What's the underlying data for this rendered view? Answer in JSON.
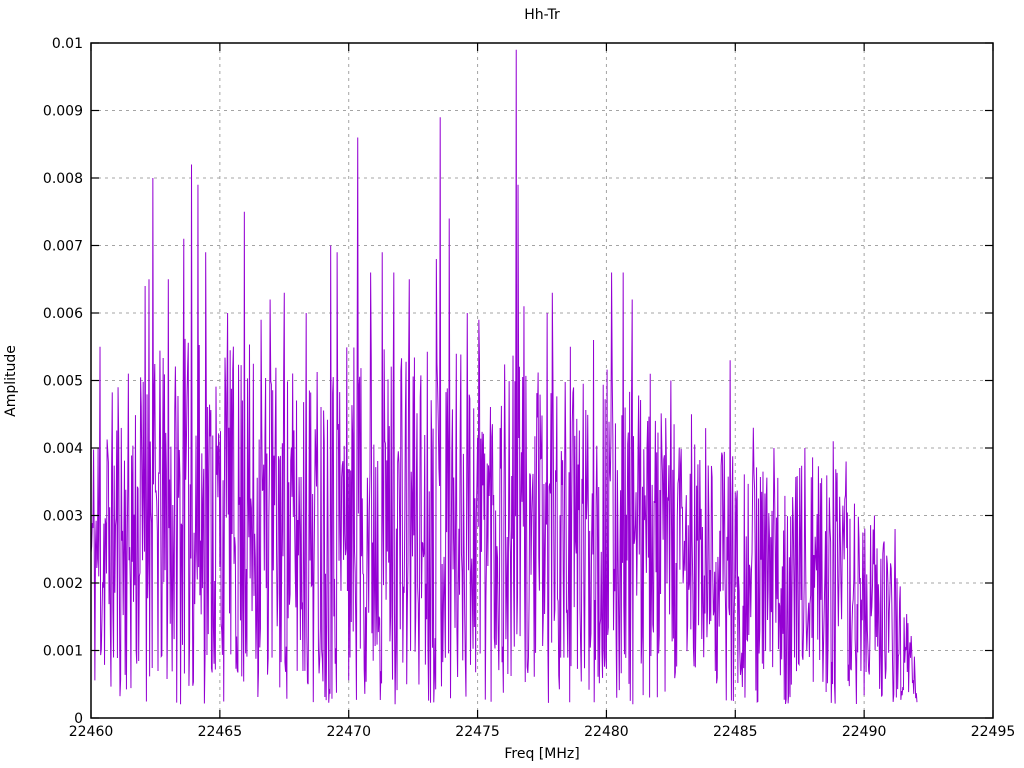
{
  "chart_data": {
    "type": "line",
    "title": "Hh-Tr",
    "xlabel": "Freq [MHz]",
    "ylabel": "Amplitude",
    "xlim": [
      22460,
      22495
    ],
    "ylim": [
      0,
      0.01
    ],
    "xtick_values": [
      22460,
      22465,
      22470,
      22475,
      22480,
      22485,
      22490,
      22495
    ],
    "xtick_labels": [
      "22460",
      "22465",
      "22470",
      "22475",
      "22480",
      "22485",
      "22490",
      "22495"
    ],
    "ytick_values": [
      0,
      0.001,
      0.002,
      0.003,
      0.004,
      0.005,
      0.006,
      0.007,
      0.008,
      0.009,
      0.01
    ],
    "ytick_labels": [
      "0",
      "0.001",
      "0.002",
      "0.003",
      "0.004",
      "0.005",
      "0.006",
      "0.007",
      "0.008",
      "0.009",
      "0.01"
    ],
    "grid": true,
    "legend_position": "none",
    "line_color": "#9400D3",
    "grid_color": "#a4a4a4",
    "border_color": "#000000",
    "data_range": [
      22460,
      22492.05
    ],
    "peaks": [
      [
        22460.35,
        0.0055
      ],
      [
        22461.05,
        0.0049
      ],
      [
        22462.1,
        0.0064
      ],
      [
        22462.25,
        0.0065
      ],
      [
        22462.4,
        0.008
      ],
      [
        22463.0,
        0.0065
      ],
      [
        22463.6,
        0.0071
      ],
      [
        22463.9,
        0.0082
      ],
      [
        22464.15,
        0.0079
      ],
      [
        22464.45,
        0.0069
      ],
      [
        22465.3,
        0.006
      ],
      [
        22465.95,
        0.0075
      ],
      [
        22466.6,
        0.0059
      ],
      [
        22466.95,
        0.0062
      ],
      [
        22467.5,
        0.0063
      ],
      [
        22468.35,
        0.006
      ],
      [
        22469.3,
        0.007
      ],
      [
        22469.55,
        0.0069
      ],
      [
        22470.35,
        0.0086
      ],
      [
        22470.85,
        0.0066
      ],
      [
        22471.3,
        0.0069
      ],
      [
        22471.75,
        0.0066
      ],
      [
        22472.35,
        0.0065
      ],
      [
        22473.4,
        0.0068
      ],
      [
        22473.55,
        0.0089
      ],
      [
        22473.9,
        0.0074
      ],
      [
        22474.6,
        0.006
      ],
      [
        22475.05,
        0.0059
      ],
      [
        22476.5,
        0.0099
      ],
      [
        22476.57,
        0.0079
      ],
      [
        22476.8,
        0.0061
      ],
      [
        22477.7,
        0.006
      ],
      [
        22477.9,
        0.0063
      ],
      [
        22478.6,
        0.0055
      ],
      [
        22479.5,
        0.0056
      ],
      [
        22480.2,
        0.0066
      ],
      [
        22480.65,
        0.0066
      ],
      [
        22481.0,
        0.0062
      ],
      [
        22481.7,
        0.0051
      ],
      [
        22482.5,
        0.005
      ],
      [
        22483.3,
        0.0045
      ],
      [
        22484.8,
        0.0053
      ],
      [
        22485.7,
        0.0043
      ],
      [
        22486.5,
        0.004
      ],
      [
        22487.7,
        0.004
      ],
      [
        22488.8,
        0.0041
      ],
      [
        22489.3,
        0.0038
      ],
      [
        22490.4,
        0.003
      ],
      [
        22491.2,
        0.0028
      ]
    ],
    "noise_model": {
      "seed": 11,
      "points_per_mhz": 40,
      "exponent": 1.0,
      "floor": 0.0002,
      "envelope_hi": [
        [
          22460,
          0.0046
        ],
        [
          22461,
          0.005
        ],
        [
          22462,
          0.0054
        ],
        [
          22463,
          0.0055
        ],
        [
          22464,
          0.0057
        ],
        [
          22465,
          0.0055
        ],
        [
          22466,
          0.0056
        ],
        [
          22467,
          0.0054
        ],
        [
          22468,
          0.0052
        ],
        [
          22469,
          0.0054
        ],
        [
          22470,
          0.0057
        ],
        [
          22471,
          0.0057
        ],
        [
          22472,
          0.0055
        ],
        [
          22473,
          0.0057
        ],
        [
          22474,
          0.0055
        ],
        [
          22475,
          0.0056
        ],
        [
          22476,
          0.0055
        ],
        [
          22477,
          0.0052
        ],
        [
          22478,
          0.005
        ],
        [
          22479,
          0.005
        ],
        [
          22480,
          0.0052
        ],
        [
          22481,
          0.0049
        ],
        [
          22482,
          0.0046
        ],
        [
          22483,
          0.0043
        ],
        [
          22484,
          0.0043
        ],
        [
          22485,
          0.0041
        ],
        [
          22486,
          0.0037
        ],
        [
          22487,
          0.0037
        ],
        [
          22488,
          0.0039
        ],
        [
          22489,
          0.0037
        ],
        [
          22490,
          0.0031
        ],
        [
          22491,
          0.0026
        ],
        [
          22491.5,
          0.002
        ],
        [
          22491.9,
          0.0012
        ],
        [
          22492.05,
          0.0004
        ]
      ]
    }
  }
}
